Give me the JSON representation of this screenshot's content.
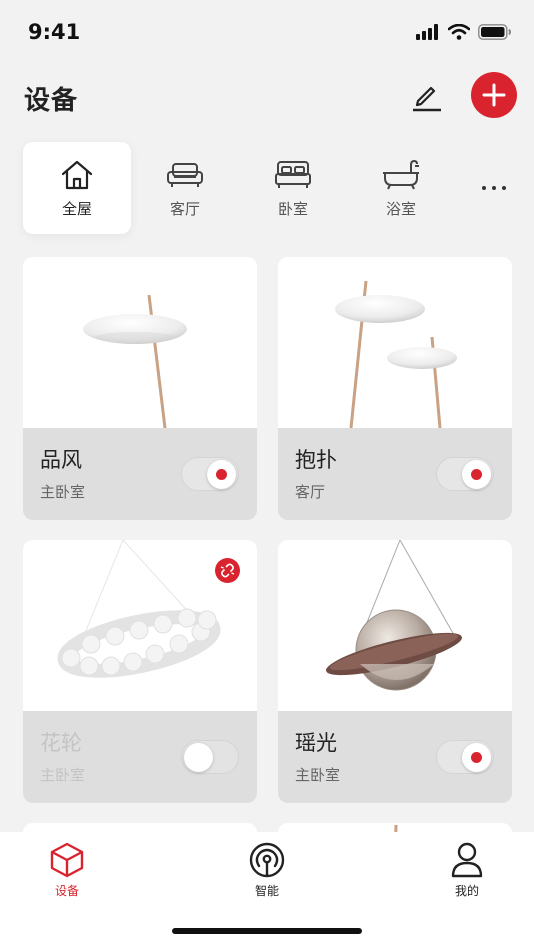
{
  "status_bar": {
    "time": "9:41"
  },
  "header": {
    "title": "设备"
  },
  "rooms": [
    {
      "label": "全屋",
      "icon": "home-icon",
      "active": true
    },
    {
      "label": "客厅",
      "icon": "sofa-icon",
      "active": false
    },
    {
      "label": "卧室",
      "icon": "bed-icon",
      "active": false
    },
    {
      "label": "浴室",
      "icon": "bathtub-icon",
      "active": false
    }
  ],
  "devices": [
    {
      "name": "品风",
      "room": "主卧室",
      "on": true,
      "online": true
    },
    {
      "name": "抱扑",
      "room": "客厅",
      "on": true,
      "online": true
    },
    {
      "name": "花轮",
      "room": "主卧室",
      "on": false,
      "online": false
    },
    {
      "name": "瑶光",
      "room": "主卧室",
      "on": true,
      "online": true
    }
  ],
  "bottom_nav": [
    {
      "label": "设备",
      "icon": "cube-icon",
      "active": true
    },
    {
      "label": "智能",
      "icon": "broadcast-icon",
      "active": false
    },
    {
      "label": "我的",
      "icon": "person-icon",
      "active": false
    }
  ],
  "colors": {
    "accent": "#d9242f",
    "background": "#f2f2f2",
    "card_footer": "#dedede"
  }
}
